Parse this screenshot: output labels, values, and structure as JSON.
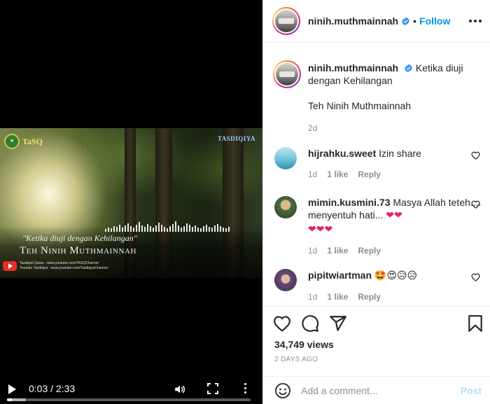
{
  "post": {
    "username": "ninih.muthmainnah",
    "follow_label": "Follow",
    "separator": "•",
    "caption_user": "ninih.muthmainnah",
    "caption_text": "Ketika diuji dengan Kehilangan",
    "caption_line2": "Teh Ninih Muthmainnah",
    "caption_age": "2d"
  },
  "video": {
    "overlay_quote": "\"Ketika diuji dengan Kehilangan\"",
    "overlay_author": "Teh Ninih Muthmainnah",
    "logo_left_text": "TaSQ",
    "logo_right_text": "TASDIQIYA",
    "channel_line1": "Tasdiqiul Quran : www.youtube.com/TASQChannel",
    "channel_line2": "Youtube Tasdiqiya : www.youtube.com/TasdiqiyaChannel",
    "time_display": "0:03 / 2:33",
    "current_seconds": 3,
    "duration_seconds": 153
  },
  "comments": [
    {
      "username": "hijrahku.sweet",
      "text": "Izin share",
      "age": "1d",
      "likes": "1 like",
      "reply": "Reply"
    },
    {
      "username": "mimin.kusmini.73",
      "text": "Masya Allah teteh.... menyentuh hati...",
      "emojis_line1": "❤❤",
      "emojis_line2": "❤❤❤",
      "age": "1d",
      "likes": "1 like",
      "reply": "Reply"
    },
    {
      "username": "pipitwiartman",
      "emojis": "🤩😍😥😥",
      "age": "1d",
      "likes": "1 like",
      "reply": "Reply"
    }
  ],
  "stats": {
    "views": "34,749 views",
    "posted": "2 DAYS AGO"
  },
  "add_comment": {
    "placeholder": "Add a comment...",
    "post_label": "Post"
  },
  "icons": [
    "play-icon",
    "volume-icon",
    "fullscreen-icon",
    "more-vertical-icon",
    "verified-icon",
    "more-horizontal-icon",
    "heart-icon",
    "comment-icon",
    "share-icon",
    "bookmark-icon",
    "emoji-icon"
  ],
  "colors": {
    "accent": "#0095f6",
    "post_disabled": "#b2dffc",
    "muted": "#8e8e8e",
    "text": "#262626"
  }
}
